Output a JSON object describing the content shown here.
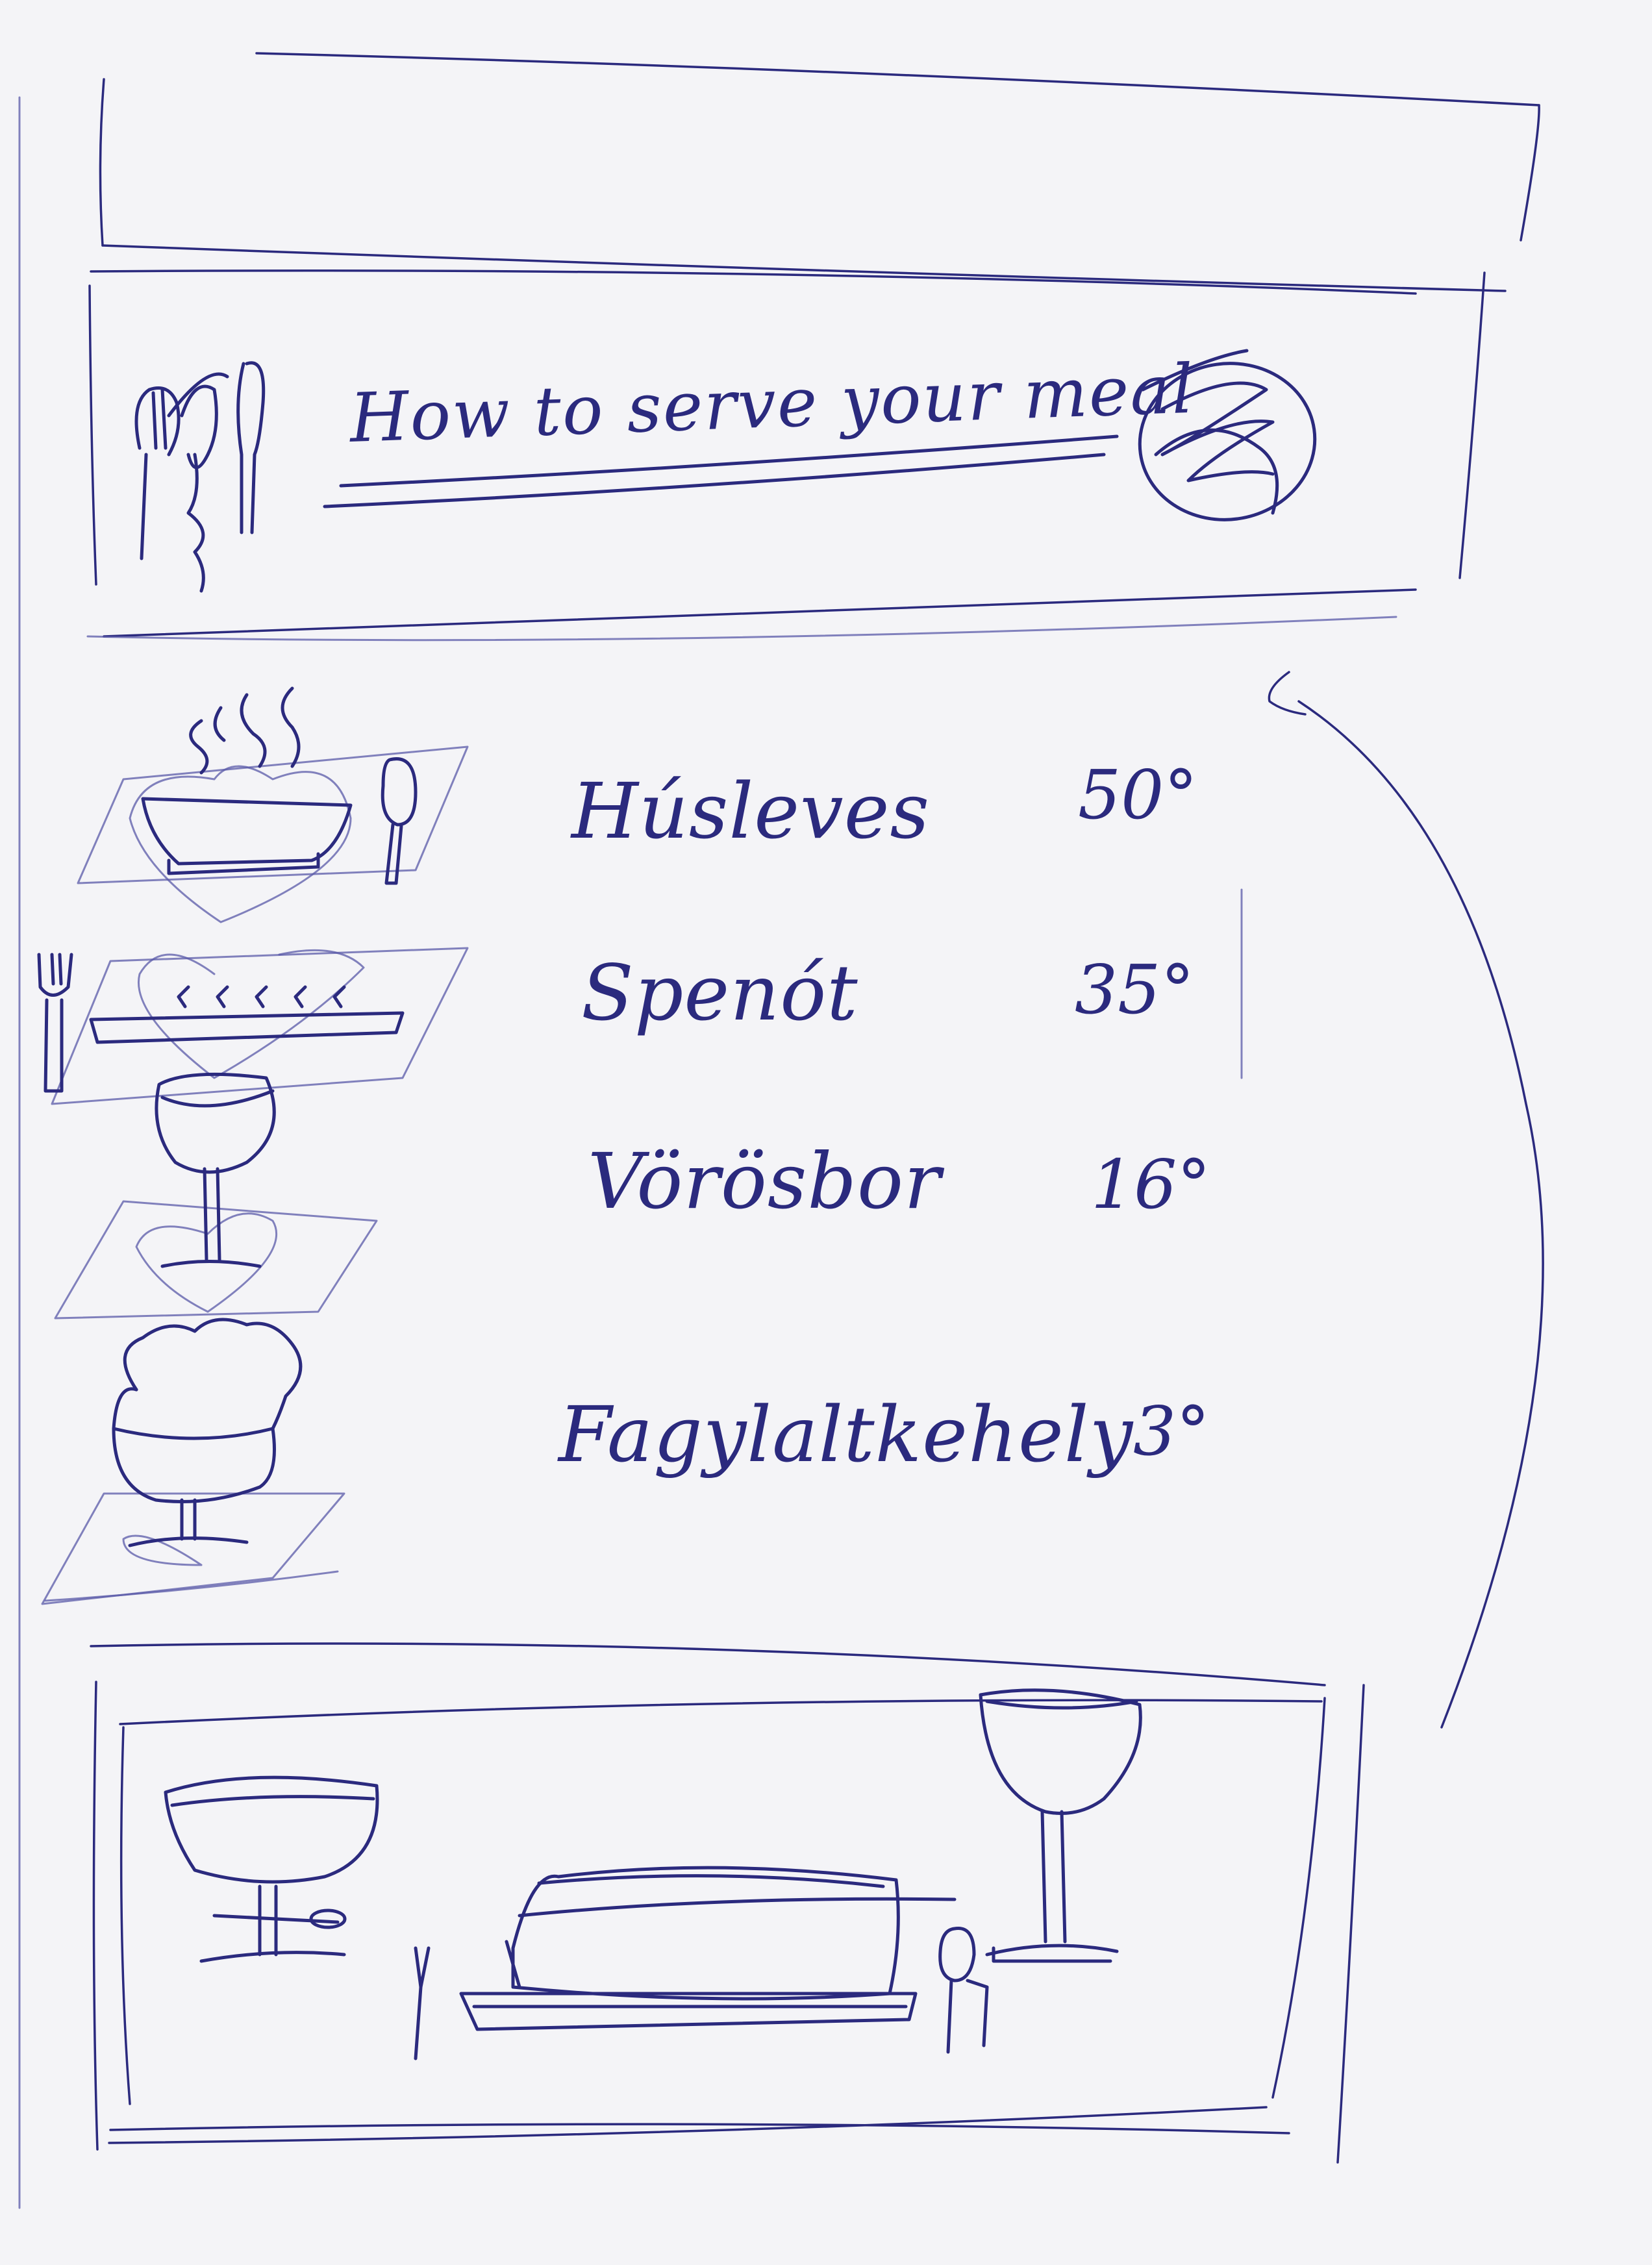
{
  "header": {
    "title": "How to serve your meal",
    "cutlery_icon": "cutlery-icon",
    "plate_icon": "plate-icon"
  },
  "menu": {
    "items": [
      {
        "name": "Húsleves",
        "temperature": "50°",
        "icon": "soup-bowl-icon"
      },
      {
        "name": "Spenót",
        "temperature": "35°",
        "icon": "main-dish-plate-icon"
      },
      {
        "name": "Vörösbor",
        "temperature": "16°",
        "icon": "wine-glass-icon"
      },
      {
        "name": "Fagylaltkehely",
        "temperature": "3°",
        "icon": "ice-cream-cup-icon"
      }
    ]
  },
  "table_setting": {
    "icons": [
      "dessert-cup-icon",
      "fork-icon",
      "covered-plate-icon",
      "spoon-icon",
      "wine-glass-icon"
    ]
  },
  "colors": {
    "ink": "#2b2a7e",
    "paper": "#f4f4f7"
  }
}
